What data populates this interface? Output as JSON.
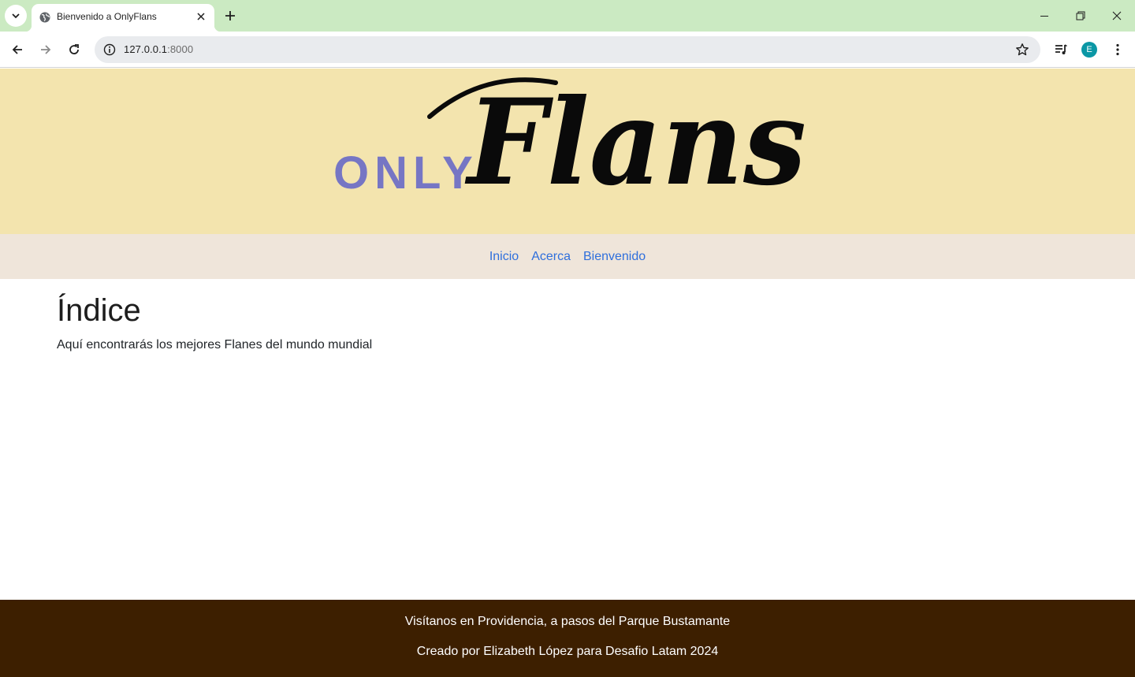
{
  "browser": {
    "tab_title": "Bienvenido a OnlyFlans",
    "url_host": "127.0.0.1",
    "url_port": ":8000",
    "profile_initial": "E",
    "icons": [
      "tab-search-icon",
      "globe-icon",
      "close-icon",
      "plus-icon",
      "minimize-icon",
      "restore-icon",
      "window-close-icon",
      "back-icon",
      "forward-icon",
      "reload-icon",
      "info-icon",
      "star-icon",
      "media-icon",
      "menu-icon"
    ]
  },
  "header": {
    "logo_text_small": "ONLY",
    "logo_text_script": "Flans",
    "logo_small_color": "#7676c4",
    "hero_color": "#f3e4ae"
  },
  "nav": {
    "items": [
      "Inicio",
      "Acerca",
      "Bienvenido"
    ],
    "link_color": "#2f6fdc"
  },
  "main": {
    "title": "Índice",
    "subtitle": "Aquí encontrarás los mejores Flanes del mundo mundial"
  },
  "footer": {
    "line1": "Visítanos en Providencia, a pasos del Parque Bustamante",
    "line2": "Creado por Elizabeth López para Desafio Latam 2024",
    "background": "#3d1f00"
  }
}
